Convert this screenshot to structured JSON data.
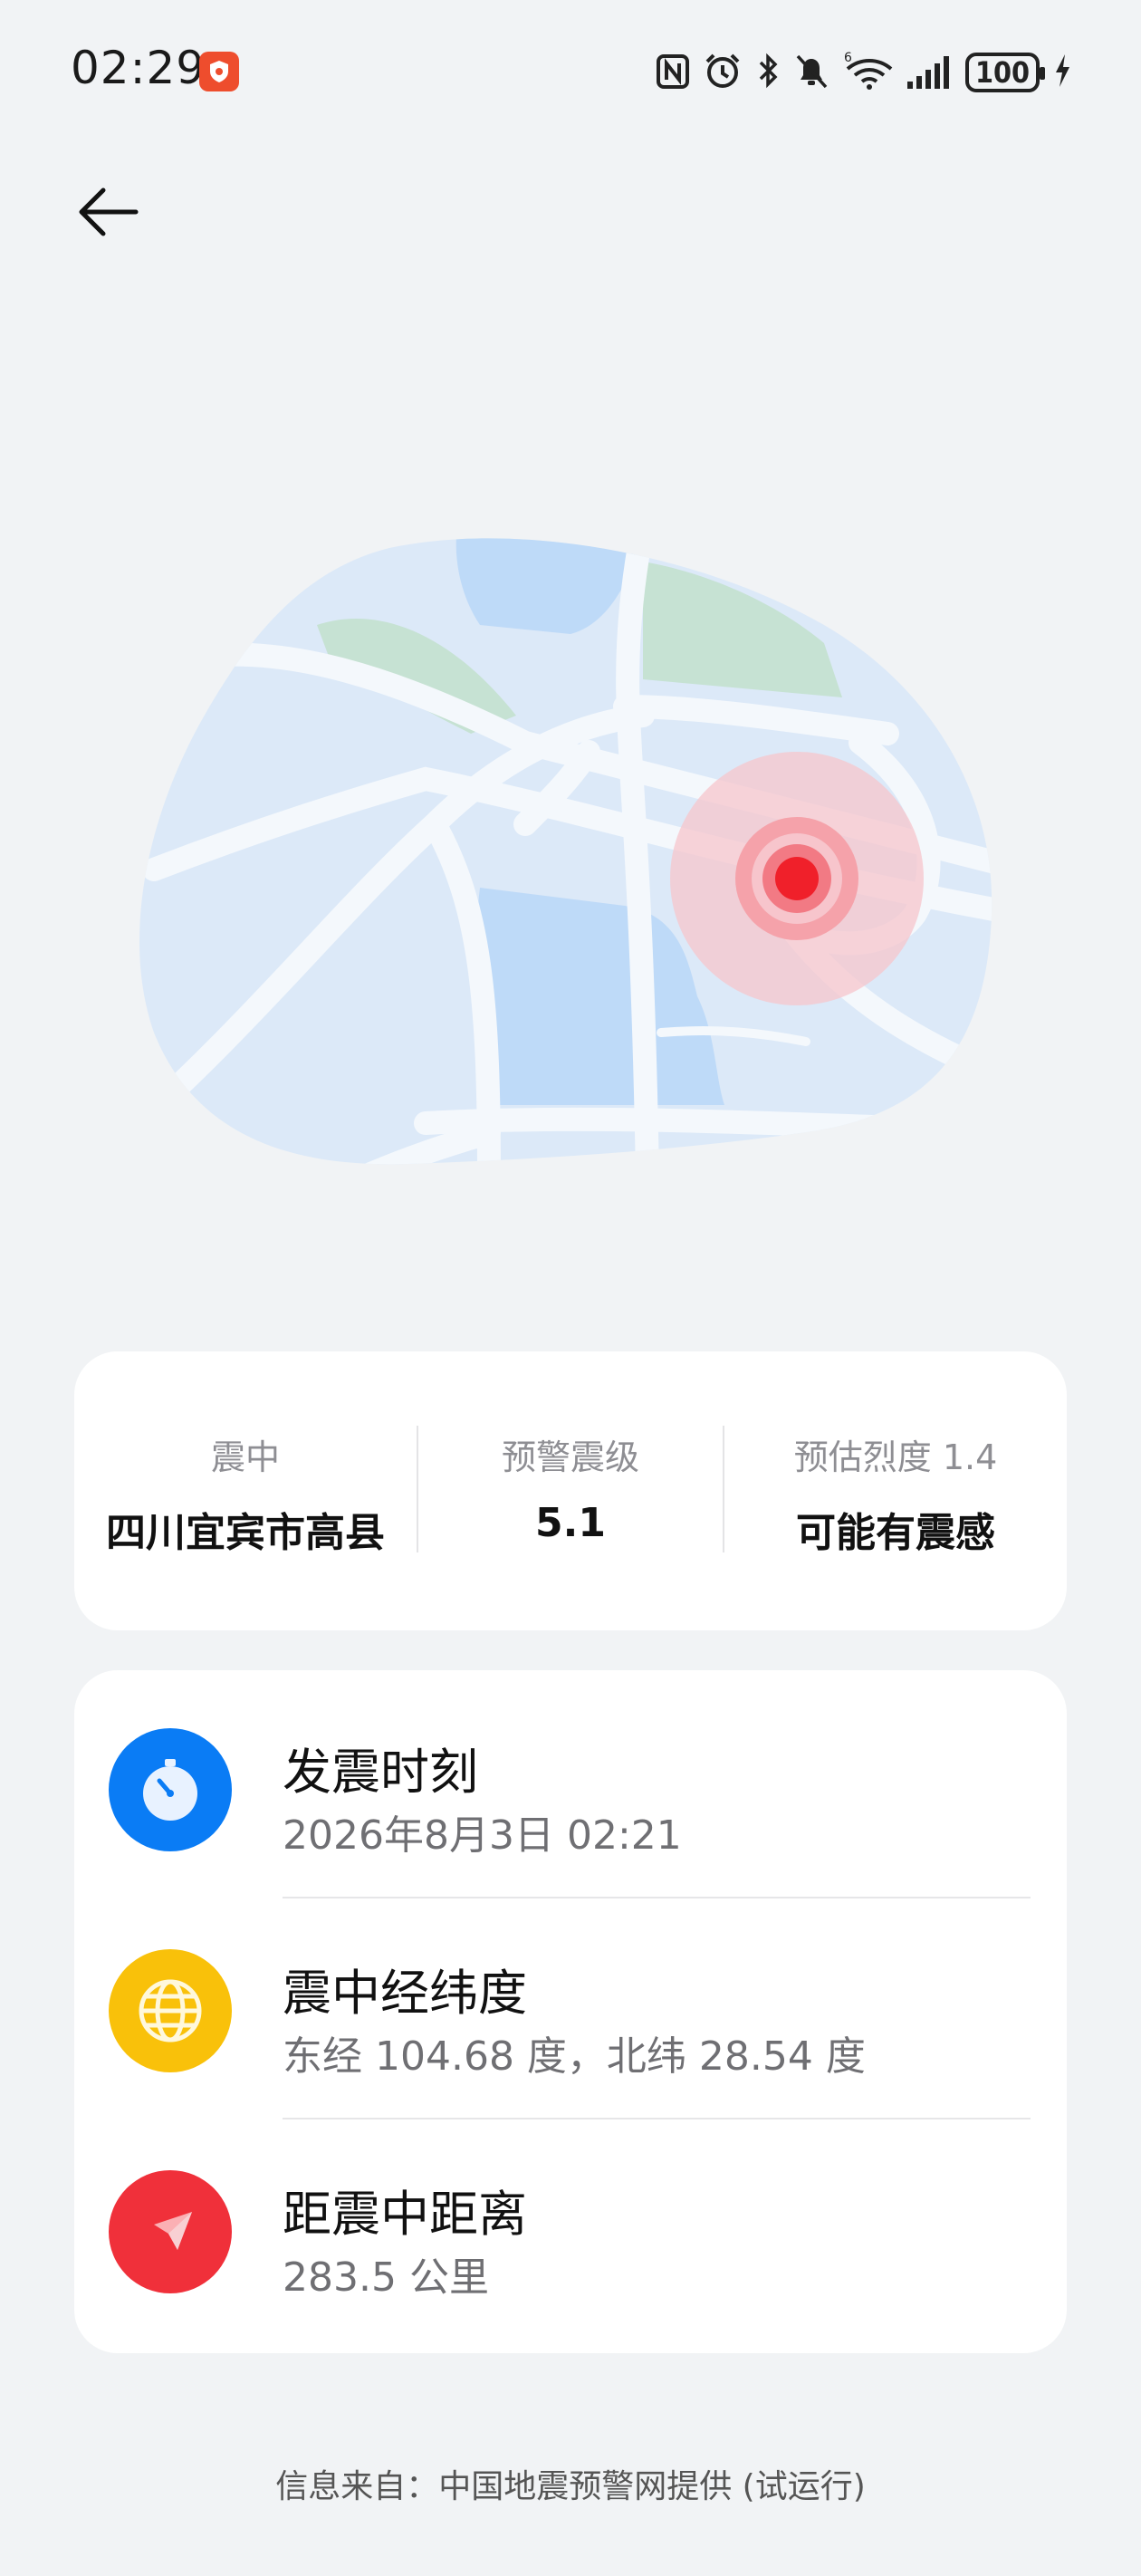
{
  "status_bar": {
    "time": "02:29",
    "battery": "100",
    "icons": [
      "app-badge-icon",
      "nfc-icon",
      "alarm-icon",
      "bluetooth-icon",
      "mute-icon",
      "wifi-icon",
      "signal-icon",
      "battery-icon",
      "charging-icon"
    ]
  },
  "colors": {
    "background": "#f1f3f5",
    "card": "#ffffff",
    "time_icon": "#0a7cf5",
    "coord_icon": "#f9c10a",
    "distance_icon": "#f0303a",
    "epicenter": "#f0202a"
  },
  "summary": {
    "epicenter_label": "震中",
    "epicenter_value": "四川宜宾市高县",
    "magnitude_label": "预警震级",
    "magnitude_value": "5.1",
    "intensity_label": "预估烈度 1.4",
    "intensity_value": "可能有震感"
  },
  "details": {
    "time_title": "发震时刻",
    "time_value": "2026年8月3日 02:21",
    "coord_title": "震中经纬度",
    "coord_value": "东经 104.68 度，北纬 28.54 度",
    "distance_title": "距震中距离",
    "distance_value": "283.5 公里"
  },
  "footer": {
    "source": "信息来自：中国地震预警网提供 (试运行)"
  }
}
